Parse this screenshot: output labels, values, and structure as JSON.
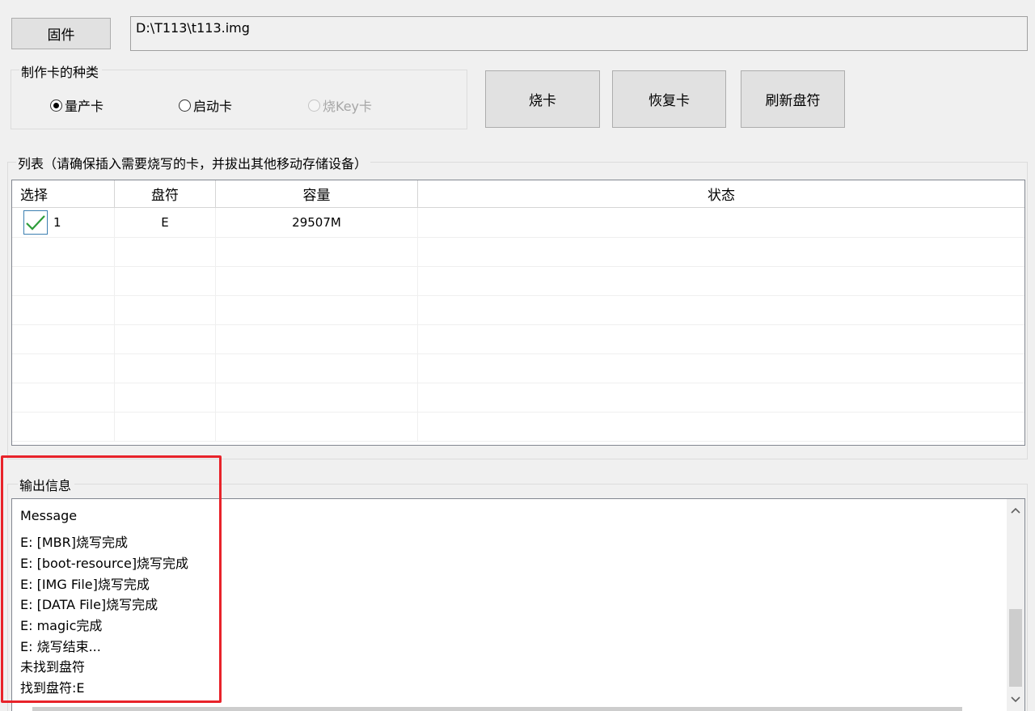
{
  "firmware": {
    "button_label": "固件",
    "path_value": "D:\\T113\\t113.img"
  },
  "card_type": {
    "legend": "制作卡的种类",
    "options": [
      {
        "label": "量产卡",
        "checked": true,
        "disabled": false
      },
      {
        "label": "启动卡",
        "checked": false,
        "disabled": false
      },
      {
        "label": "烧Key卡",
        "checked": false,
        "disabled": true
      }
    ]
  },
  "actions": {
    "burn_label": "烧卡",
    "restore_label": "恢复卡",
    "refresh_label": "刷新盘符"
  },
  "list": {
    "legend": "列表（请确保插入需要烧写的卡，并拔出其他移动存储设备）",
    "columns": [
      "选择",
      "盘符",
      "容量",
      "状态"
    ],
    "rows": [
      {
        "checked": true,
        "index": "1",
        "drive": "E",
        "capacity": "29507M",
        "status": ""
      }
    ]
  },
  "output": {
    "legend": "输出信息",
    "lines": [
      "Message",
      "E: [MBR]烧写完成",
      "E: [boot-resource]烧写完成",
      "E: [IMG File]烧写完成",
      "E: [DATA File]烧写完成",
      "E: magic完成",
      "E: 烧写结束...",
      "未找到盘符",
      "找到盘符:E"
    ]
  },
  "icons": {
    "check": "checkmark-icon",
    "scroll_up": "chevron-up-icon",
    "scroll_down": "chevron-down-icon"
  },
  "colors": {
    "highlight_box": "#e8232a",
    "check_green": "#2e9d3a",
    "window_bg": "#f0f0f0"
  }
}
